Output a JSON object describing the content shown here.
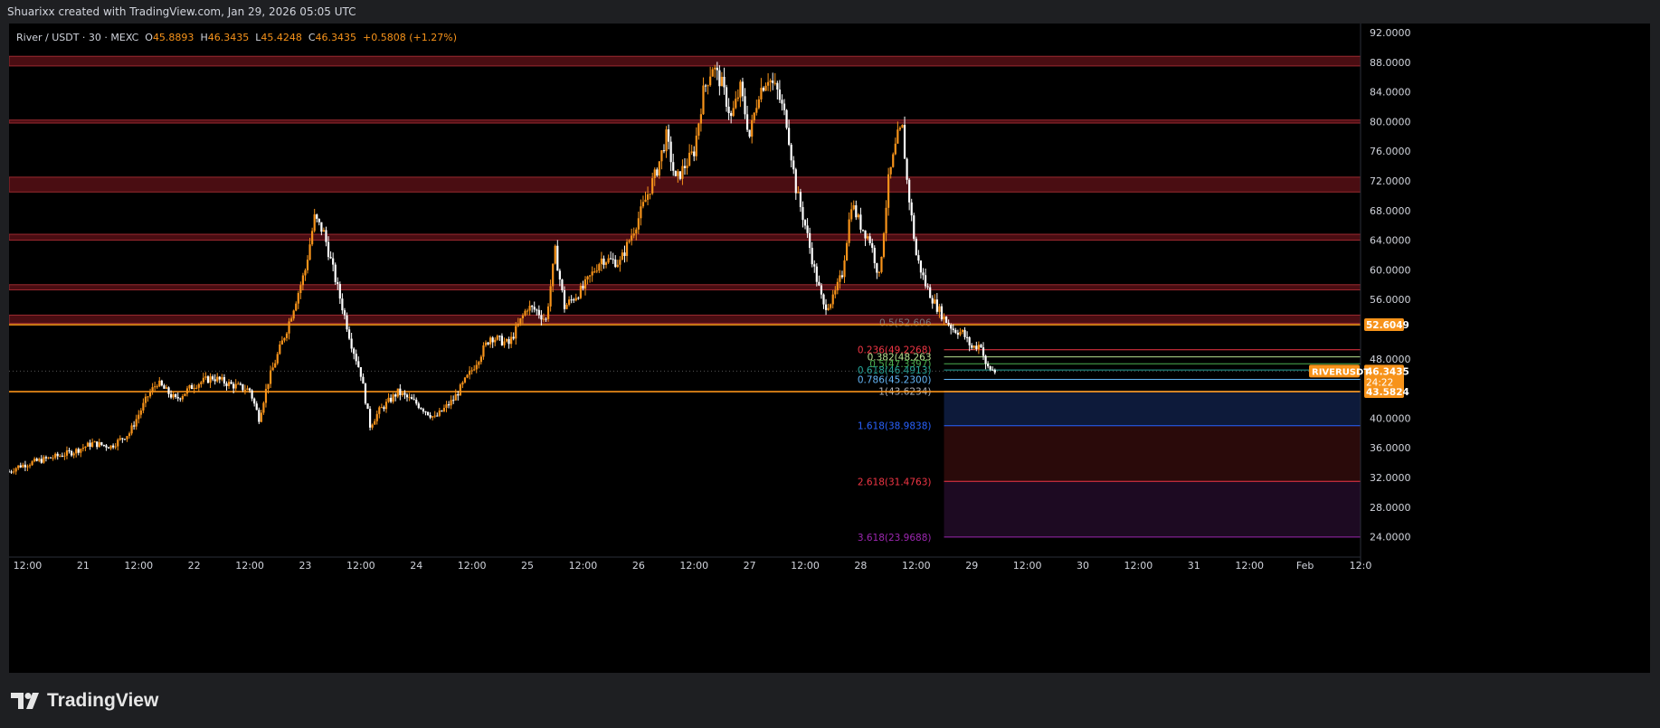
{
  "caption": "Shuarixx created with TradingView.com, Jan 29, 2026 05:05 UTC",
  "brand": "TradingView",
  "header": {
    "symbol": "River / USDT · 30 · MEXC",
    "o_label": "O",
    "o": "45.8893",
    "h_label": "H",
    "h": "46.3435",
    "l_label": "L",
    "l": "45.4248",
    "c_label": "C",
    "c": "46.3435",
    "change": "+0.5808 (+1.27%)"
  },
  "colors": {
    "up": "#f7931a",
    "down": "#ffffff",
    "zone_fill": "#4a0d12",
    "zone_stroke": "#9c2a30",
    "level_line": "#f7931a",
    "axis_text": "#d1d4dc"
  },
  "chart_data": {
    "type": "candlestick",
    "title": "River / USDT · 30 · MEXC",
    "ylim": [
      22,
      93
    ],
    "y_ticks": [
      92,
      88,
      84,
      80,
      76,
      72,
      68,
      64,
      60,
      56,
      48,
      40,
      36,
      32,
      28,
      24
    ],
    "y_tick_labels": [
      "92.0000",
      "88.0000",
      "84.0000",
      "80.0000",
      "76.0000",
      "72.0000",
      "68.0000",
      "64.0000",
      "60.0000",
      "56.0000",
      "48.0000",
      "40.0000",
      "36.0000",
      "32.0000",
      "28.0000",
      "24.0000"
    ],
    "x_range": [
      "2026-01-20T08:00",
      "2026-02-01T12:00"
    ],
    "x_tick_labels": [
      {
        "t": "2026-01-20T12:00",
        "label": "12:00"
      },
      {
        "t": "2026-01-21T00:00",
        "label": "21"
      },
      {
        "t": "2026-01-21T12:00",
        "label": "12:00"
      },
      {
        "t": "2026-01-22T00:00",
        "label": "22"
      },
      {
        "t": "2026-01-22T12:00",
        "label": "12:00"
      },
      {
        "t": "2026-01-23T00:00",
        "label": "23"
      },
      {
        "t": "2026-01-23T12:00",
        "label": "12:00"
      },
      {
        "t": "2026-01-24T00:00",
        "label": "24"
      },
      {
        "t": "2026-01-24T12:00",
        "label": "12:00"
      },
      {
        "t": "2026-01-25T00:00",
        "label": "25"
      },
      {
        "t": "2026-01-25T12:00",
        "label": "12:00"
      },
      {
        "t": "2026-01-26T00:00",
        "label": "26"
      },
      {
        "t": "2026-01-26T12:00",
        "label": "12:00"
      },
      {
        "t": "2026-01-27T00:00",
        "label": "27"
      },
      {
        "t": "2026-01-27T12:00",
        "label": "12:00"
      },
      {
        "t": "2026-01-28T00:00",
        "label": "28"
      },
      {
        "t": "2026-01-28T12:00",
        "label": "12:00"
      },
      {
        "t": "2026-01-29T00:00",
        "label": "29"
      },
      {
        "t": "2026-01-29T12:00",
        "label": "12:00"
      },
      {
        "t": "2026-01-30T00:00",
        "label": "30"
      },
      {
        "t": "2026-01-30T12:00",
        "label": "12:00"
      },
      {
        "t": "2026-01-31T00:00",
        "label": "31"
      },
      {
        "t": "2026-01-31T12:00",
        "label": "12:00"
      },
      {
        "t": "2026-02-01T00:00",
        "label": "Feb"
      },
      {
        "t": "2026-02-01T12:00",
        "label": "12:0"
      }
    ],
    "price_path": [
      [
        "2026-01-20T08:00",
        32.8
      ],
      [
        "2026-01-20T10:00",
        33.5
      ],
      [
        "2026-01-20T14:00",
        34.2
      ],
      [
        "2026-01-20T18:00",
        34.8
      ],
      [
        "2026-01-20T22:00",
        35.5
      ],
      [
        "2026-01-21T02:00",
        36.6
      ],
      [
        "2026-01-21T06:00",
        36.2
      ],
      [
        "2026-01-21T10:00",
        38.0
      ],
      [
        "2026-01-21T14:00",
        43.0
      ],
      [
        "2026-01-21T16:00",
        44.8
      ],
      [
        "2026-01-21T20:00",
        42.5
      ],
      [
        "2026-01-22T00:00",
        44.5
      ],
      [
        "2026-01-22T04:00",
        45.5
      ],
      [
        "2026-01-22T08:00",
        44.5
      ],
      [
        "2026-01-22T12:00",
        43.8
      ],
      [
        "2026-01-22T14:00",
        40.0
      ],
      [
        "2026-01-22T16:00",
        45.0
      ],
      [
        "2026-01-22T20:00",
        52.0
      ],
      [
        "2026-01-23T00:00",
        60.0
      ],
      [
        "2026-01-23T02:00",
        67.0
      ],
      [
        "2026-01-23T04:00",
        65.0
      ],
      [
        "2026-01-23T06:00",
        60.0
      ],
      [
        "2026-01-23T10:00",
        50.0
      ],
      [
        "2026-01-23T12:00",
        46.0
      ],
      [
        "2026-01-23T14:00",
        39.0
      ],
      [
        "2026-01-23T16:00",
        41.0
      ],
      [
        "2026-01-23T20:00",
        43.5
      ],
      [
        "2026-01-24T00:00",
        42.0
      ],
      [
        "2026-01-24T04:00",
        40.0
      ],
      [
        "2026-01-24T08:00",
        42.5
      ],
      [
        "2026-01-24T12:00",
        46.5
      ],
      [
        "2026-01-24T16:00",
        51.0
      ],
      [
        "2026-01-24T20:00",
        50.0
      ],
      [
        "2026-01-25T00:00",
        55.0
      ],
      [
        "2026-01-25T02:00",
        54.5
      ],
      [
        "2026-01-25T04:00",
        53.2
      ],
      [
        "2026-01-25T06:00",
        62.5
      ],
      [
        "2026-01-25T08:00",
        55.0
      ],
      [
        "2026-01-25T12:00",
        57.5
      ],
      [
        "2026-01-25T16:00",
        61.5
      ],
      [
        "2026-01-25T20:00",
        61.0
      ],
      [
        "2026-01-26T00:00",
        67.0
      ],
      [
        "2026-01-26T04:00",
        73.5
      ],
      [
        "2026-01-26T06:00",
        78.0
      ],
      [
        "2026-01-26T08:00",
        72.0
      ],
      [
        "2026-01-26T12:00",
        76.0
      ],
      [
        "2026-01-26T14:00",
        84.0
      ],
      [
        "2026-01-26T16:00",
        87.5
      ],
      [
        "2026-01-26T18:00",
        85.0
      ],
      [
        "2026-01-26T20:00",
        80.5
      ],
      [
        "2026-01-26T22:00",
        84.5
      ],
      [
        "2026-01-27T00:00",
        78.0
      ],
      [
        "2026-01-27T02:00",
        84.0
      ],
      [
        "2026-01-27T04:00",
        86.0
      ],
      [
        "2026-01-27T06:00",
        84.0
      ],
      [
        "2026-01-27T08:00",
        80.0
      ],
      [
        "2026-01-27T10:00",
        71.0
      ],
      [
        "2026-01-27T12:00",
        66.0
      ],
      [
        "2026-01-27T14:00",
        60.0
      ],
      [
        "2026-01-27T16:00",
        55.0
      ],
      [
        "2026-01-27T18:00",
        56.0
      ],
      [
        "2026-01-27T20:00",
        59.5
      ],
      [
        "2026-01-27T22:00",
        69.0
      ],
      [
        "2026-01-28T00:00",
        66.0
      ],
      [
        "2026-01-28T02:00",
        64.0
      ],
      [
        "2026-01-28T04:00",
        59.0
      ],
      [
        "2026-01-28T06:00",
        72.0
      ],
      [
        "2026-01-28T08:00",
        78.0
      ],
      [
        "2026-01-28T09:00",
        79.0
      ],
      [
        "2026-01-28T10:00",
        72.0
      ],
      [
        "2026-01-28T12:00",
        62.0
      ],
      [
        "2026-01-28T14:00",
        58.0
      ],
      [
        "2026-01-28T16:00",
        55.5
      ],
      [
        "2026-01-28T18:00",
        53.5
      ],
      [
        "2026-01-28T20:00",
        52.0
      ],
      [
        "2026-01-28T22:00",
        51.5
      ],
      [
        "2026-01-29T00:00",
        49.5
      ],
      [
        "2026-01-29T02:00",
        50.0
      ],
      [
        "2026-01-29T03:00",
        47.0
      ],
      [
        "2026-01-29T05:00",
        46.3
      ]
    ],
    "zones": [
      {
        "low": 87.5,
        "high": 88.8
      },
      {
        "low": 79.8,
        "high": 80.2
      },
      {
        "low": 70.5,
        "high": 72.5
      },
      {
        "low": 64.0,
        "high": 64.8
      },
      {
        "low": 57.3,
        "high": 58.0
      },
      {
        "low": 52.8,
        "high": 53.9
      }
    ],
    "horizontal_levels": [
      {
        "price": 52.6049,
        "label": "52.6049"
      },
      {
        "price": 43.5824,
        "label": "43.5824"
      }
    ],
    "fib": {
      "start": "2026-01-28T18:00",
      "end": "2026-02-01T12:00",
      "levels": [
        {
          "ratio": "0.236",
          "price": "49.2268",
          "label": "0.236(49.2268)",
          "color": "#f23645",
          "shown_label": "0.236(49.2268)"
        },
        {
          "ratio": "0.382",
          "price": "48.2634",
          "label": "0.382(48.2634)",
          "color": "#b7e08f",
          "shown_label": "0.382(48.263"
        },
        {
          "ratio": "0.5",
          "price": "47.3397",
          "label": "0.5(47.3397)",
          "color": "#4caf50",
          "shown_label": "0.5(47.3397)"
        },
        {
          "ratio": "0.618",
          "price": "46.4913",
          "label": "0.618(46.4913)",
          "color": "#26a69a",
          "shown_label": "0.618(46.4913)"
        },
        {
          "ratio": "0.786",
          "price": "45.2300",
          "label": "0.786(45.2300)",
          "color": "#64b5f6",
          "shown_label": "0.786(45.2300)"
        },
        {
          "ratio": "1",
          "price": "43.6234",
          "label": "1(43.6234)",
          "color": "#b0b3bb",
          "shown_label": "1(43.6234)"
        },
        {
          "ratio": "1.618",
          "price": "38.9838",
          "label": "1.618(38.9838)",
          "color": "#2962ff",
          "shown_label": "1.618(38.9838)"
        },
        {
          "ratio": "2.618",
          "price": "31.4763",
          "label": "2.618(31.4763)",
          "color": "#f23645",
          "shown_label": "2.618(31.4763)"
        },
        {
          "ratio": "3.618",
          "price": "23.9688",
          "label": "3.618(23.9688)",
          "color": "#9c27b0",
          "shown_label": "3.618(23.9688)"
        }
      ],
      "bands": [
        {
          "from": 43.6234,
          "to": 38.9838,
          "color": "#0d1a3a"
        },
        {
          "from": 38.9838,
          "to": 31.4763,
          "color": "#2a0a0a"
        },
        {
          "from": 31.4763,
          "to": 23.9688,
          "color": "#1d0a22"
        }
      ],
      "top_label_partial": "0.5(52.606"
    },
    "last_price": {
      "ticker": "RIVERUSDT",
      "price": "46.3435",
      "countdown": "24:22"
    }
  }
}
